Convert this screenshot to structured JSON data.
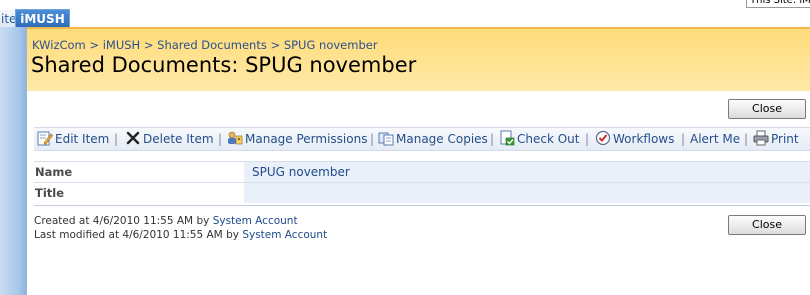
{
  "top_nav": {
    "left_tab_label": "ite",
    "active_tab_label": "iMUSH",
    "site_label": "This Site: iMU"
  },
  "breadcrumb": {
    "items": [
      "KWizCom",
      "iMUSH",
      "Shared Documents",
      "SPUG november"
    ],
    "separator": ">"
  },
  "page_title": "Shared Documents: SPUG november",
  "close_button_label": "Close",
  "toolbar": {
    "items": [
      {
        "label": "Edit Item",
        "icon": "edit-icon"
      },
      {
        "label": "Delete Item",
        "icon": "delete-icon"
      },
      {
        "label": "Manage Permissions",
        "icon": "permissions-icon"
      },
      {
        "label": "Manage Copies",
        "icon": "copies-icon"
      },
      {
        "label": "Check Out",
        "icon": "checkout-icon"
      },
      {
        "label": "Workflows",
        "icon": "workflow-icon"
      },
      {
        "label": "Alert Me",
        "icon": ""
      },
      {
        "label": "Print",
        "icon": "print-icon"
      }
    ],
    "separator": "|"
  },
  "properties": [
    {
      "label": "Name",
      "value": "SPUG november"
    },
    {
      "label": "Title",
      "value": ""
    }
  ],
  "created": {
    "prefix": "Created at 4/6/2010 11:55 AM  by",
    "user": "System Account"
  },
  "modified": {
    "prefix": "Last modified at 4/6/2010 11:55 AM  by",
    "user": "System Account"
  },
  "colors": {
    "title_band": "#ffdc7a",
    "link": "#254e8c",
    "value_cell": "#eaf0f9"
  }
}
